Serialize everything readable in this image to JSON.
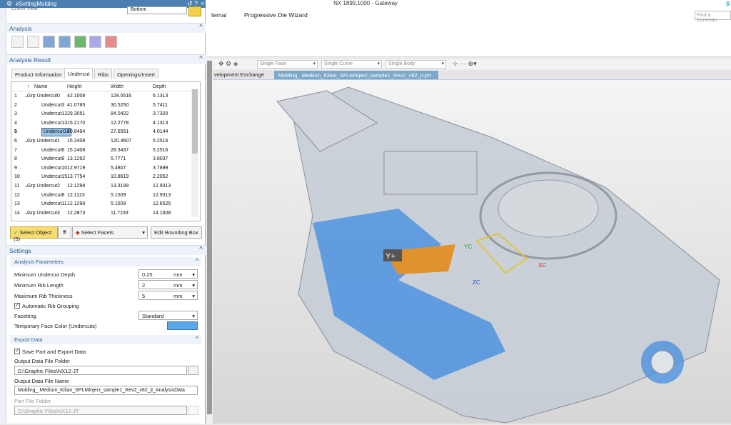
{
  "app_title": "NX 1899.1000 - Gateway",
  "ribbon_tabs": [
    "ternal",
    "Progressive Die Wizard"
  ],
  "find_command_placeholder": "Find a Comman",
  "selection_bar": {
    "face": "Single Face",
    "curve": "Single Curve",
    "body": "Single Body"
  },
  "doc_tabs": [
    "velopment Exchange",
    "Molding_ Medium_Kilian_SPLMInject_sample1_Rev2_v82_jt.prt"
  ],
  "dialog": {
    "title": "#SettingMolding",
    "check_view_label": "Check View",
    "check_view_value": "Bottom",
    "analysis_section": "Analysis",
    "analysis_result_section": "Analysis Result",
    "tabs": [
      "Product Information",
      "Undercut",
      "Ribs",
      "Openings/Insert"
    ],
    "active_tab": "Undercut",
    "table": {
      "headers": [
        "Name",
        "Height",
        "Width",
        "Depth"
      ],
      "rows": [
        {
          "n": "1",
          "name": "Grp Undercut0",
          "h": "42.1008",
          "w": "128.5516",
          "d": "6.1313",
          "group": true
        },
        {
          "n": "2",
          "name": "Undercut3",
          "h": "41.0785",
          "w": "30.5250",
          "d": "5.7411",
          "group": false
        },
        {
          "n": "3",
          "name": "Undercut12",
          "h": "29.3051",
          "w": "84.0422",
          "d": "3.7320",
          "group": false
        },
        {
          "n": "4",
          "name": "Undercut13",
          "h": "15.2170",
          "w": "12.2778",
          "d": "4.1313",
          "group": false
        },
        {
          "n": "5",
          "name": "Undercut14",
          "h": "20.8494",
          "w": "27.5551",
          "d": "4.0144",
          "group": false,
          "selected": true
        },
        {
          "n": "6",
          "name": "Grp Undercut1",
          "h": "15.2408",
          "w": "120.4607",
          "d": "5.2516",
          "group": true
        },
        {
          "n": "7",
          "name": "Undercut6",
          "h": "15.2408",
          "w": "28.3437",
          "d": "5.2516",
          "group": false
        },
        {
          "n": "8",
          "name": "Undercut9",
          "h": "13.1292",
          "w": "5.7771",
          "d": "3.8037",
          "group": false
        },
        {
          "n": "9",
          "name": "Undercut10",
          "h": "12.9719",
          "w": "5.4807",
          "d": "3.7899",
          "group": false
        },
        {
          "n": "10",
          "name": "Undercut15",
          "h": "13.7754",
          "w": "10.8619",
          "d": "2.2052",
          "group": false
        },
        {
          "n": "11",
          "name": "Grp Undercut2",
          "h": "12.1298",
          "w": "13.3199",
          "d": "12.9313",
          "group": true
        },
        {
          "n": "12",
          "name": "Undercut8",
          "h": "12.1123",
          "w": "5.1509",
          "d": "12.9313",
          "group": false
        },
        {
          "n": "13",
          "name": "Undercut11",
          "h": "12.1298",
          "w": "5.1509",
          "d": "12.6525",
          "group": false
        },
        {
          "n": "14",
          "name": "Grp Undercut3",
          "h": "12.2873",
          "w": "11.7233",
          "d": "14.1608",
          "group": true
        }
      ]
    },
    "select_object": "Select Object (5)",
    "select_facets": "Select Facets",
    "edit_bbox": "Edit Bounding Box",
    "settings_section": "Settings",
    "analysis_params": "Analysis Parameters",
    "min_undercut_depth": {
      "label": "Minimum Undercut Depth",
      "value": "0.25",
      "unit": "mm"
    },
    "min_rib_length": {
      "label": "Minimum Rib Length",
      "value": "2",
      "unit": "mm"
    },
    "max_rib_thickness": {
      "label": "Maximum Rib Thickness",
      "value": "5",
      "unit": "mm"
    },
    "auto_rib_grouping": "Automatic Rib Grouping",
    "facetting": {
      "label": "Facetting",
      "value": "Standard"
    },
    "temp_face_color": {
      "label": "Temporary Face Color (Undercuts)",
      "color": "#5aa7ea"
    },
    "export_data": "Export Data",
    "save_part": "Save Part and Export Data",
    "output_folder": {
      "label": "Output Data File Folder",
      "value": "D:\\Graphic Files\\NX12-JT"
    },
    "output_name": {
      "label": "Output Data File Name",
      "value": "Molding_ Medium_Kilian_SPLMInject_sample1_Rev2_v82_jt_AnalysisData"
    },
    "part_folder": {
      "label": "Part File Folder",
      "value": "D:\\Graphic Files\\NX12-JT"
    }
  },
  "viewport_labels": {
    "y_plus": "Y+",
    "yc": "YC",
    "xc": "XC",
    "zc": "ZC"
  },
  "colors": {
    "title_bar": "#4b7fb0",
    "undercut_blue": "#3e8be0",
    "highlight_orange": "#e08a1c"
  }
}
